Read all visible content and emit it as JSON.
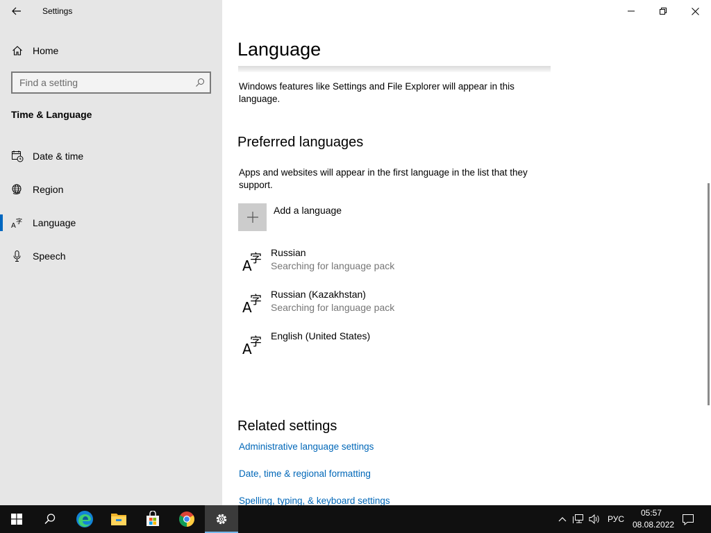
{
  "window": {
    "app_title": "Settings",
    "minimize_icon": "minimize-icon",
    "restore_icon": "restore-icon",
    "close_icon": "close-icon"
  },
  "sidebar": {
    "home_label": "Home",
    "search_placeholder": "Find a setting",
    "section_heading": "Time & Language",
    "items": [
      {
        "label": "Date & time",
        "icon": "date-time-icon"
      },
      {
        "label": "Region",
        "icon": "region-globe-icon"
      },
      {
        "label": "Language",
        "icon": "language-icon",
        "selected": true
      },
      {
        "label": "Speech",
        "icon": "microphone-icon"
      }
    ]
  },
  "main": {
    "page_title": "Language",
    "display_language_text": "Windows features like Settings and File Explorer will appear in this language.",
    "preferred_heading": "Preferred languages",
    "preferred_text": "Apps and websites will appear in the first language in the list that they support.",
    "add_language_label": "Add a language",
    "languages": [
      {
        "name": "Russian",
        "status": "Searching for language pack"
      },
      {
        "name": "Russian (Kazakhstan)",
        "status": "Searching for language pack"
      },
      {
        "name": "English (United States)",
        "status": ""
      }
    ],
    "related_heading": "Related settings",
    "related_links": [
      "Administrative language settings",
      "Date, time & regional formatting",
      "Spelling, typing, & keyboard settings"
    ]
  },
  "taskbar": {
    "apps": [
      "start-icon",
      "search-icon",
      "edge-icon",
      "file-explorer-icon",
      "store-icon",
      "chrome-icon",
      "settings-gear-icon"
    ],
    "input_language": "РУС",
    "time": "05:57",
    "date": "08.08.2022",
    "accent_color": "#76b9ed"
  },
  "colors": {
    "sidebar_bg": "#e6e6e6",
    "accent": "#0067c0",
    "link": "#0067b8",
    "taskbar_bg": "#101010"
  }
}
